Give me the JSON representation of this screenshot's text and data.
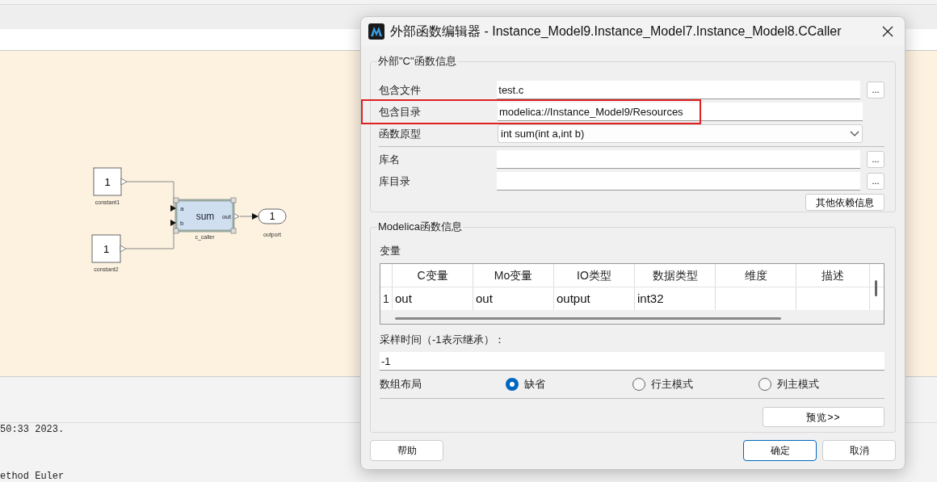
{
  "canvas": {
    "blocks": [
      {
        "kind": "constant",
        "value": "1",
        "label": "constant1"
      },
      {
        "kind": "constant",
        "value": "1",
        "label": "constant2"
      },
      {
        "kind": "caller",
        "value": "sum",
        "label": "c_caller",
        "inputs": [
          "a",
          "b"
        ],
        "output": "out",
        "selected": true
      },
      {
        "kind": "outport",
        "value": "1",
        "label": "outport"
      }
    ]
  },
  "log": {
    "lines": [
      "50:33 2023.",
      "ethod Euler"
    ]
  },
  "dialog": {
    "title": "外部函数编辑器 - Instance_Model9.Instance_Model7.Instance_Model8.CCaller",
    "c_group": {
      "title": "外部\"C\"函数信息",
      "fields": [
        {
          "kind": "text",
          "label": "包含文件",
          "value": "test.c",
          "browse": "..."
        },
        {
          "kind": "text",
          "label": "包含目录",
          "value": "modelica://Instance_Model9/Resources",
          "highlighted": true
        },
        {
          "kind": "dropdown",
          "label": "函数原型",
          "value": "int sum(int a,int b)"
        },
        {
          "kind": "text",
          "label": "库名",
          "browse": "...",
          "separator_before": true
        },
        {
          "kind": "text",
          "label": "库目录",
          "browse": "..."
        }
      ],
      "more_button": "其他依赖信息"
    },
    "modelica_group": {
      "title": "Modelica函数信息",
      "variables_label": "变量",
      "table": {
        "columns": [
          "C变量",
          "Mo变量",
          "IO类型",
          "数据类型",
          "维度",
          "描述"
        ],
        "rows": [
          {
            "index": "1",
            "cells": [
              "out",
              "out",
              "output",
              "int32"
            ]
          }
        ]
      },
      "sample_time": {
        "label": "采样时间（-1表示继承）：",
        "value": "-1"
      },
      "array_layout": {
        "label": "数组布局",
        "options": [
          {
            "label": "缺省",
            "selected": true
          },
          {
            "label": "行主模式",
            "selected": false
          },
          {
            "label": "列主模式",
            "selected": false
          }
        ]
      },
      "preview_button": "预览>>"
    },
    "buttons": [
      {
        "kind": "help",
        "label": "帮助"
      },
      {
        "kind": "default",
        "label": "确定"
      },
      {
        "kind": "normal",
        "label": "取消"
      }
    ]
  }
}
